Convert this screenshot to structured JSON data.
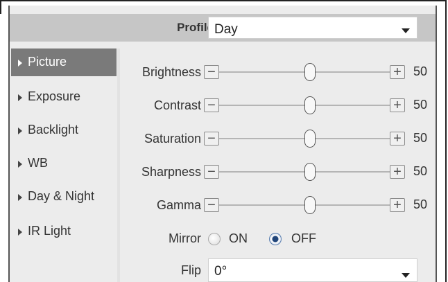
{
  "profile": {
    "label": "Profile",
    "value": "Day"
  },
  "nav": {
    "items": [
      {
        "label": "Picture",
        "active": true
      },
      {
        "label": "Exposure",
        "active": false
      },
      {
        "label": "Backlight",
        "active": false
      },
      {
        "label": "WB",
        "active": false
      },
      {
        "label": "Day & Night",
        "active": false
      },
      {
        "label": "IR Light",
        "active": false
      }
    ]
  },
  "sliders": [
    {
      "label": "Brightness",
      "value": "50",
      "level": 50
    },
    {
      "label": "Contrast",
      "value": "50",
      "level": 50
    },
    {
      "label": "Saturation",
      "value": "50",
      "level": 50
    },
    {
      "label": "Sharpness",
      "value": "50",
      "level": 50
    },
    {
      "label": "Gamma",
      "value": "50",
      "level": 50
    }
  ],
  "slider_buttons": {
    "minus": "−",
    "plus": "+"
  },
  "mirror": {
    "label": "Mirror",
    "on_label": "ON",
    "off_label": "OFF",
    "selected": "OFF"
  },
  "flip": {
    "label": "Flip",
    "value": "0°"
  }
}
